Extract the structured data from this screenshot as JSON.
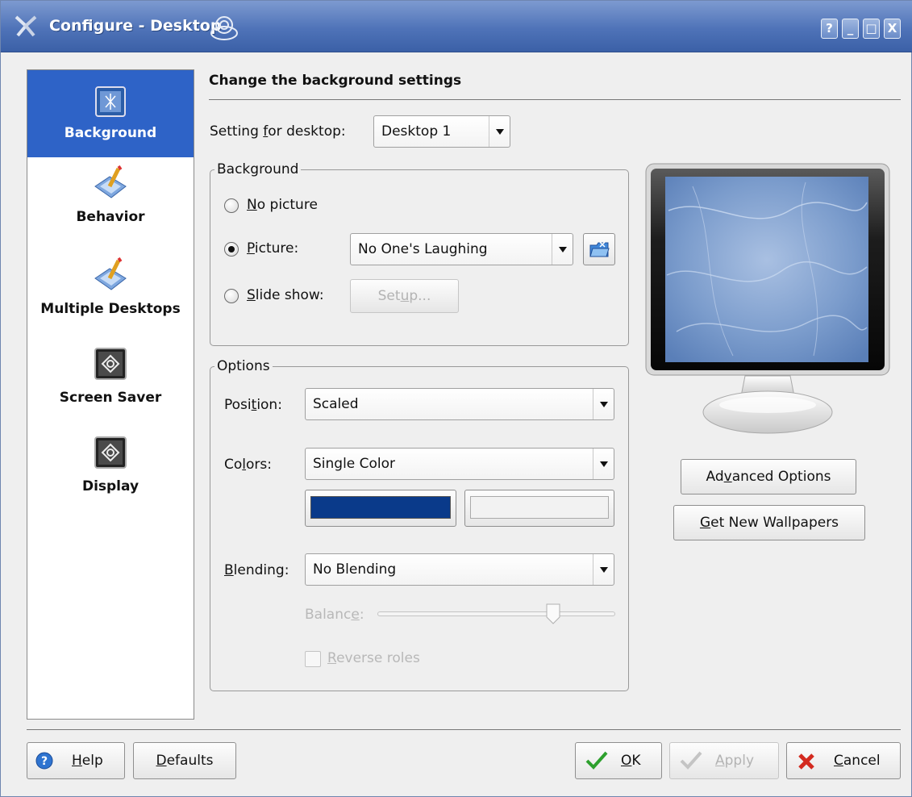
{
  "window": {
    "title": "Configure - Desktop",
    "title_buttons": [
      "?",
      "_",
      "□",
      "X"
    ]
  },
  "sidebar": {
    "items": [
      {
        "label": "Background",
        "icon": "background-icon",
        "active": true
      },
      {
        "label": "Behavior",
        "icon": "behavior-icon"
      },
      {
        "label": "Multiple Desktops",
        "icon": "multiple-desktops-icon"
      },
      {
        "label": "Screen Saver",
        "icon": "screen-saver-icon"
      },
      {
        "label": "Display",
        "icon": "display-icon"
      }
    ]
  },
  "header": {
    "title": "Change the background settings"
  },
  "setting_for_desktop": {
    "label_prefix": "Setting ",
    "label_accel": "f",
    "label_suffix": "or desktop:",
    "value": "Desktop 1"
  },
  "background_group": {
    "title": "Background",
    "no_picture": {
      "accel": "N",
      "rest": "o picture"
    },
    "picture": {
      "accel": "P",
      "rest": "icture:",
      "value": "No One's Laughing"
    },
    "slide_show": {
      "accel": "S",
      "rest": "lide show:"
    },
    "setup_button": {
      "pre": "Set",
      "accel": "u",
      "post": "p..."
    }
  },
  "options_group": {
    "title": "Options",
    "position": {
      "pre": "Posi",
      "accel": "t",
      "post": "ion:",
      "value": "Scaled"
    },
    "colors": {
      "pre": "Co",
      "accel": "l",
      "post": "ors:",
      "value": "Single Color",
      "color1": "#0a3a8a",
      "color2": "#f2f2f2"
    },
    "blending": {
      "accel": "B",
      "post": "lending:",
      "value": "No Blending"
    },
    "balance": {
      "pre": "Balanc",
      "accel": "e",
      "post": ":",
      "level": 0.74
    },
    "reverse_roles": {
      "accel": "R",
      "post": "everse roles"
    }
  },
  "buttons": {
    "advanced": {
      "pre": "Ad",
      "accel": "v",
      "post": "anced Options"
    },
    "get_new": {
      "accel": "G",
      "post": "et New Wallpapers"
    },
    "help": {
      "accel": "H",
      "post": "elp"
    },
    "defaults": {
      "accel": "D",
      "post": "efaults"
    },
    "ok": {
      "accel": "O",
      "post": "K"
    },
    "apply": {
      "accel": "A",
      "post": "pply"
    },
    "cancel": {
      "accel": "C",
      "post": "ancel"
    }
  },
  "colors": {
    "accent": "#2e63c7",
    "titlebar": "#4f73b8"
  }
}
